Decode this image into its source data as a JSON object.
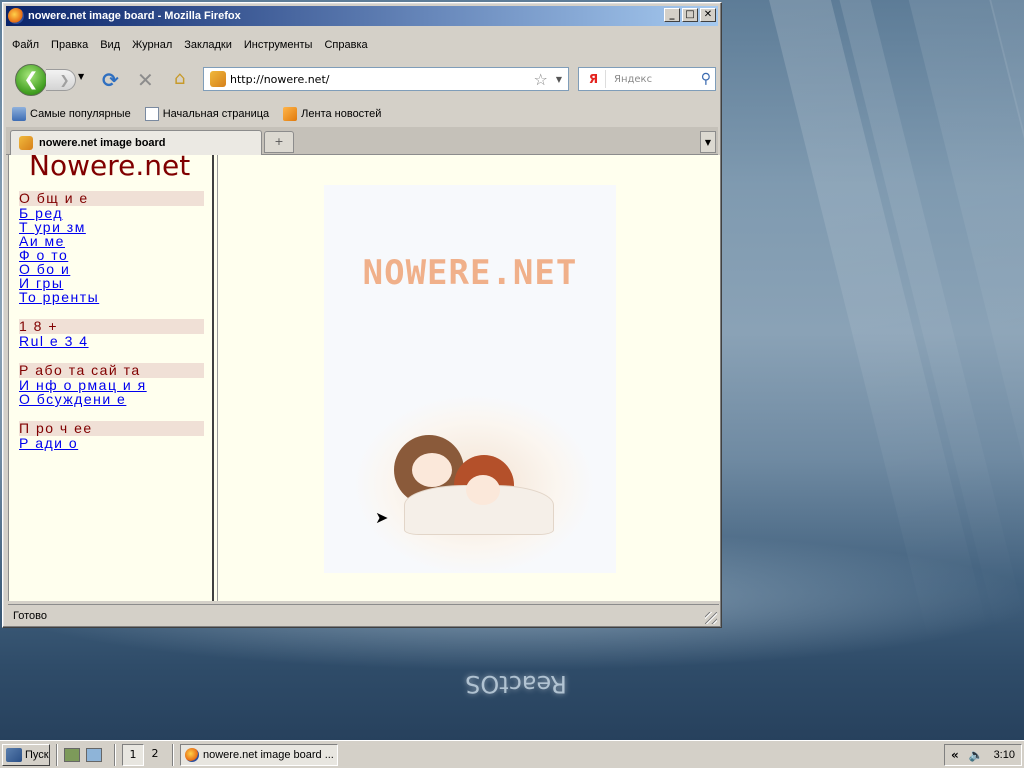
{
  "window": {
    "title": "nowere.net image board - Mozilla Firefox",
    "buttons": {
      "minimize": "_",
      "maximize": "□",
      "close": "✕"
    }
  },
  "menu": [
    "Файл",
    "Правка",
    "Вид",
    "Журнал",
    "Закладки",
    "Инструменты",
    "Справка"
  ],
  "nav": {
    "back_icon": "back-arrow-icon",
    "url": "http://nowere.net/",
    "search_placeholder": "Яндекс",
    "search_engine_label": "Я"
  },
  "bookmarks": [
    "Самые популярные",
    "Начальная страница",
    "Лента новостей"
  ],
  "tab": {
    "label": "nowere.net image board",
    "new_tab": "+"
  },
  "page": {
    "site_title": "Nowere.net",
    "sections": [
      {
        "heading": "О бщ и е",
        "links": [
          "Б ред",
          "Т ури зм",
          "Аи ме",
          "Ф о то",
          "О бо и",
          "И гры",
          "То рренты"
        ]
      },
      {
        "heading": "1 8 +",
        "links": [
          "Rul e 3 4"
        ]
      },
      {
        "heading": "Р або та сай та",
        "links": [
          "И нф о рмац и я",
          "О бсуждени е"
        ]
      },
      {
        "heading": "П ро ч ее",
        "links": [
          "Р ади о"
        ]
      }
    ],
    "banner_text": "NOWERE.NET"
  },
  "status": "Готово",
  "taskbar": {
    "start": "Пуск",
    "workspaces": [
      "1",
      "2"
    ],
    "task": "nowere.net image board ...",
    "clock": "3:10",
    "tray_arrow": "«"
  },
  "desktop": {
    "logo": "ReactOS"
  }
}
